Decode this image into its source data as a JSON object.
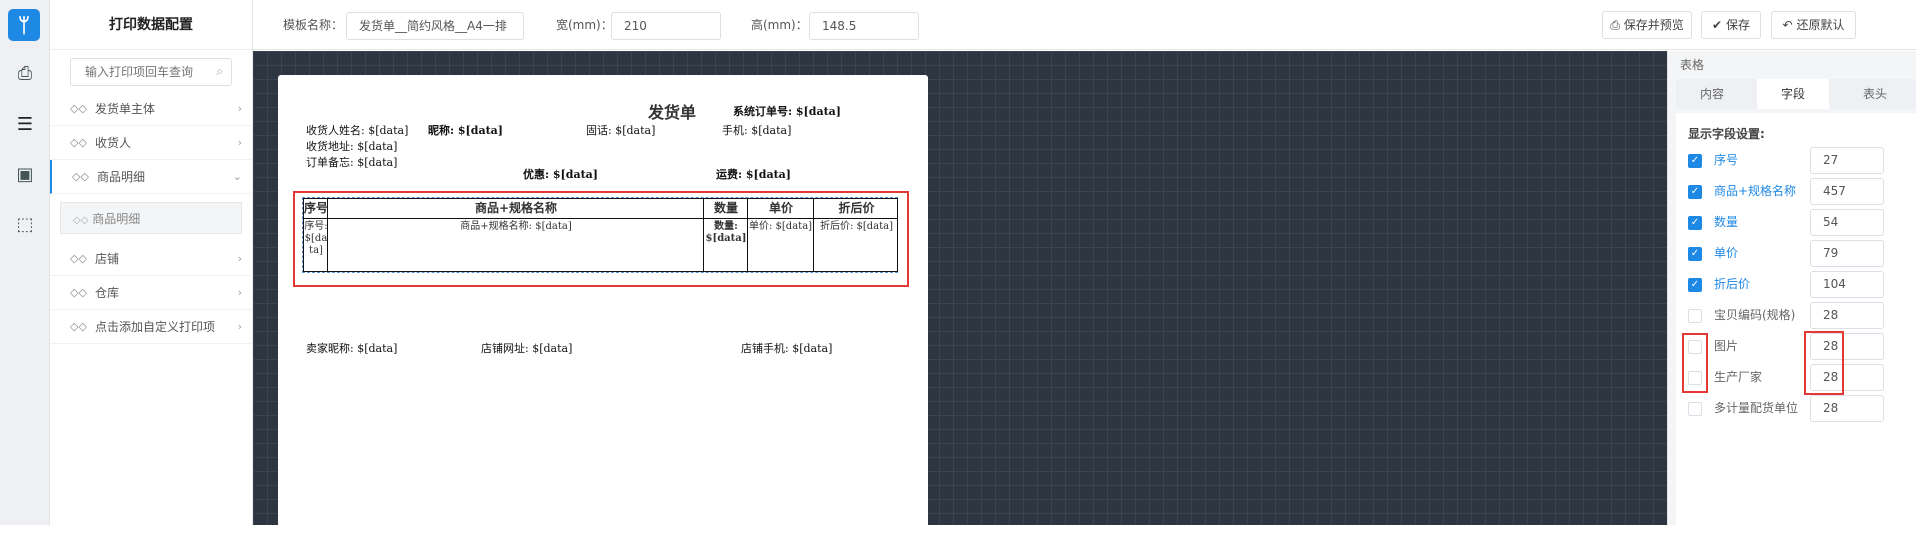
{
  "sidebar": {
    "title": "打印数据配置",
    "search_placeholder": "输入打印项回车查询",
    "items": [
      {
        "label": "发货单主体"
      },
      {
        "label": "收货人"
      },
      {
        "label": "商品明细"
      },
      {
        "label": "店铺"
      },
      {
        "label": "仓库"
      },
      {
        "label": "点击添加自定义打印项"
      }
    ],
    "sub_item": "商品明细"
  },
  "topbar": {
    "template_name_label": "模板名称：",
    "template_name_value": "发货单__简约风格__A4一排",
    "width_label": "宽(mm)：",
    "width_value": "210",
    "height_label": "高(mm)：",
    "height_value": "148.5",
    "save_preview": "保存并预览",
    "save": "保存",
    "restore": "还原默认"
  },
  "paper": {
    "title": "发货单",
    "order_no": "系统订单号: $[data]",
    "receiver_name": "收货人姓名: $[data]",
    "nickname": "昵称: $[data]",
    "phone": "固话: $[data]",
    "mobile": "手机: $[data]",
    "address": "收货地址: $[data]",
    "remark": "订单备忘: $[data]",
    "discount": "优惠: $[data]",
    "shipping": "运费: $[data]",
    "table": {
      "headers": [
        "序号",
        "商品+规格名称",
        "数量",
        "单价",
        "折后价"
      ],
      "cells": [
        "序号:\n$[da\nta]",
        "商品+规格名称: $[data]",
        "数量:\n$[data]",
        "单价: $[data]",
        "折后价: $[data]"
      ]
    },
    "seller_nick": "卖家昵称: $[data]",
    "shop_url": "店铺网址: $[data]",
    "shop_mobile": "店铺手机: $[data]"
  },
  "right_panel": {
    "header": "表格",
    "tabs": [
      "内容",
      "字段",
      "表头"
    ],
    "active_tab": "字段",
    "section_title": "显示字段设置:",
    "fields": [
      {
        "label": "序号",
        "value": "27",
        "checked": true
      },
      {
        "label": "商品+规格名称",
        "value": "457",
        "checked": true
      },
      {
        "label": "数量",
        "value": "54",
        "checked": true
      },
      {
        "label": "单价",
        "value": "79",
        "checked": true
      },
      {
        "label": "折后价",
        "value": "104",
        "checked": true
      },
      {
        "label": "宝贝编码(规格)",
        "value": "28",
        "checked": false
      },
      {
        "label": "图片",
        "value": "28",
        "checked": false
      },
      {
        "label": "生产厂家",
        "value": "28",
        "checked": false
      },
      {
        "label": "多计量配货单位",
        "value": "28",
        "checked": false
      }
    ]
  },
  "colors": {
    "accent": "#1e88e5",
    "highlight": "#e53935",
    "canvas": "#2c3540"
  }
}
